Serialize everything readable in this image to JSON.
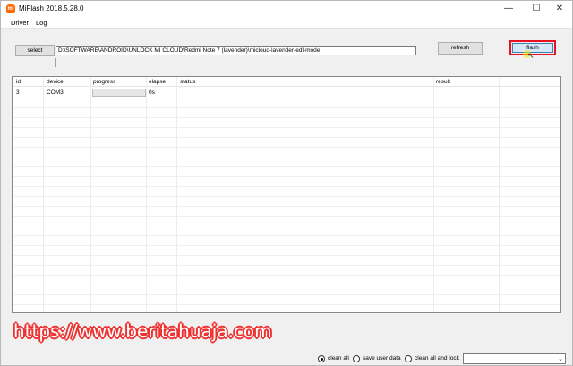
{
  "window": {
    "title": "MiFlash 2018.5.28.0",
    "icon_glyph": "mi",
    "controls": {
      "minimize": "—",
      "maximize": "☐",
      "close": "✕"
    }
  },
  "menu": {
    "items": [
      "Driver",
      "Log"
    ]
  },
  "toolbar": {
    "select_label": "select",
    "path_value": "D:\\SOFTWARE\\ANDROID\\UNLOCK MI CLOUD\\Redmi Note 7 (lavender)\\micloud-lavender-edl-mode",
    "refresh_label": "refresh",
    "flash_label": "flash",
    "flash_highlight_color": "#e81123"
  },
  "table": {
    "columns": [
      "id",
      "device",
      "progress",
      "elapse",
      "status",
      "result"
    ],
    "rows": [
      {
        "id": "3",
        "device": "COM3",
        "progress": 0,
        "elapse": "0s",
        "status": "",
        "result": ""
      }
    ]
  },
  "watermark": "https://www.beritahuaja.com",
  "footer": {
    "options": [
      "clean all",
      "save user data",
      "clean all and lock"
    ],
    "selected": "clean all",
    "dropdown_value": ""
  }
}
